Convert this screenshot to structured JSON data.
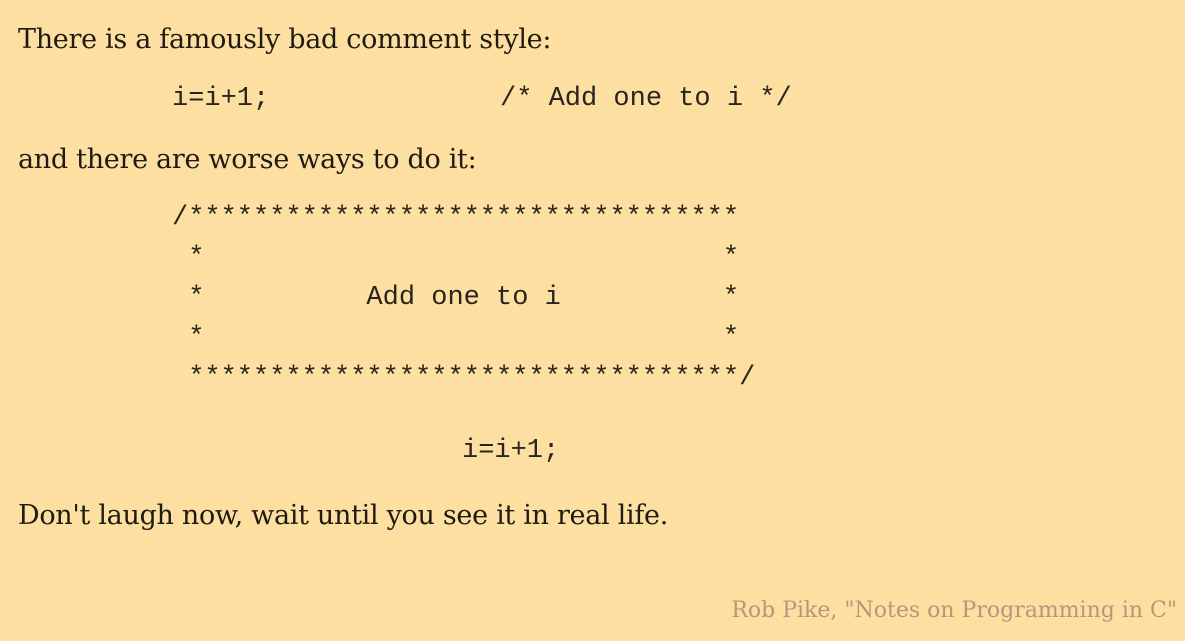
{
  "slide": {
    "line1": "There is a famously bad comment style:",
    "code1": {
      "statement": "i=i+1;",
      "comment": "/* Add one to i */"
    },
    "line2": "and there are worse ways to do it:",
    "comment_block": [
      "/**********************************",
      " *                                *",
      " *          Add one to i          *",
      " *                                *",
      " **********************************/"
    ],
    "code2": "i=i+1;",
    "line3": "Don't laugh now, wait until you see it in real life.",
    "attribution": "Rob Pike, \"Notes on Programming in C\""
  }
}
